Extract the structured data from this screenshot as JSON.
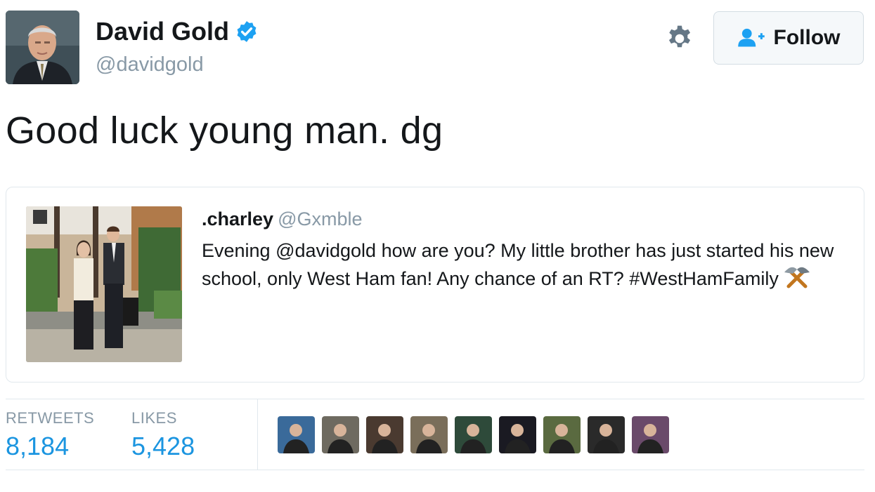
{
  "author": {
    "name": "David Gold",
    "handle": "@davidgold",
    "avatar_icon": "profile-photo-icon",
    "verified_icon": "verified-badge-icon"
  },
  "actions": {
    "settings_icon": "gear-icon",
    "follow_label": "Follow",
    "follow_icon": "add-user-icon"
  },
  "tweet": {
    "text": "Good luck young man. dg"
  },
  "quoted_tweet": {
    "name": ".charley",
    "handle": "@Gxmble",
    "image_icon": "photo-icon",
    "text": "Evening @davidgold how are you? My little brother has just started his new school, only West Ham fan! Any chance of an RT? #WestHamFamily",
    "emoji_icon": "hammer-and-pick-icon"
  },
  "stats": {
    "retweets_label": "RETWEETS",
    "retweets_value": "8,184",
    "likes_label": "LIKES",
    "likes_value": "5,428"
  },
  "likers": {
    "count_shown": 9,
    "colors": [
      "#3a6a9a",
      "#6e6a60",
      "#4a3a30",
      "#7a6e5a",
      "#2e4a3a",
      "#1a1a22",
      "#5a6a40",
      "#2a2a2a",
      "#6a4a6a"
    ]
  },
  "colors": {
    "link_blue": "#1b95e0",
    "muted_gray": "#8899a6",
    "border": "#e1e8ed"
  }
}
